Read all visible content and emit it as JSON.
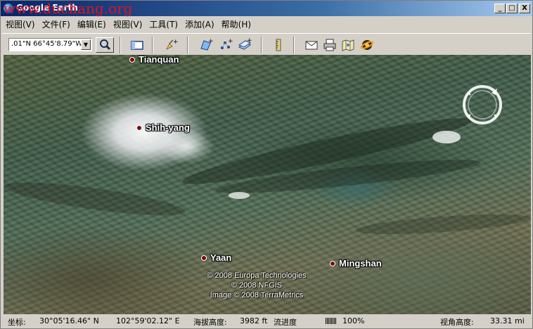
{
  "window": {
    "title": "Google Earth",
    "watermark": "www.duchang.org",
    "controls": {
      "minimize": "_",
      "maximize": "□",
      "close": "X"
    }
  },
  "menu": [
    {
      "label": "视图(V)"
    },
    {
      "label": "文件(F)"
    },
    {
      "label": "编辑(E)"
    },
    {
      "label": "视图(V)"
    },
    {
      "label": "工具(T)"
    },
    {
      "label": "添加(A)"
    },
    {
      "label": "帮助(H)"
    }
  ],
  "toolbar": {
    "coordinate_value": ".01\"N 66°45'8.79\"W",
    "icons": [
      "search-icon",
      "sidebar-toggle-icon",
      "add-placemark-icon",
      "add-polygon-icon",
      "add-path-icon",
      "add-image-overlay-icon",
      "ruler-icon",
      "email-icon",
      "print-icon",
      "google-maps-icon",
      "sky-icon"
    ]
  },
  "map": {
    "places": [
      {
        "name": "Tianquan"
      },
      {
        "name": "Shih-yang"
      },
      {
        "name": "Yaan"
      },
      {
        "name": "Mingshan"
      }
    ],
    "credits": [
      "© 2008 Europa Technologies",
      "© 2008 NFGIS",
      "Image © 2008 TerraMetrics"
    ]
  },
  "status": {
    "coord_label": "坐标:",
    "lat": "30°05'16.46\" N",
    "lon": "102°59'02.12\" E",
    "elevation_label": "海拔高度:",
    "elevation": "3982 ft",
    "streaming_label": "流进度",
    "streaming_percent": "100%",
    "eye_alt_label": "视角高度:",
    "eye_alt": "33.31 mi"
  },
  "colors": {
    "titlebar_start": "#0a246a",
    "watermark": "#e0141e",
    "place_dot": "#7a0a12"
  }
}
